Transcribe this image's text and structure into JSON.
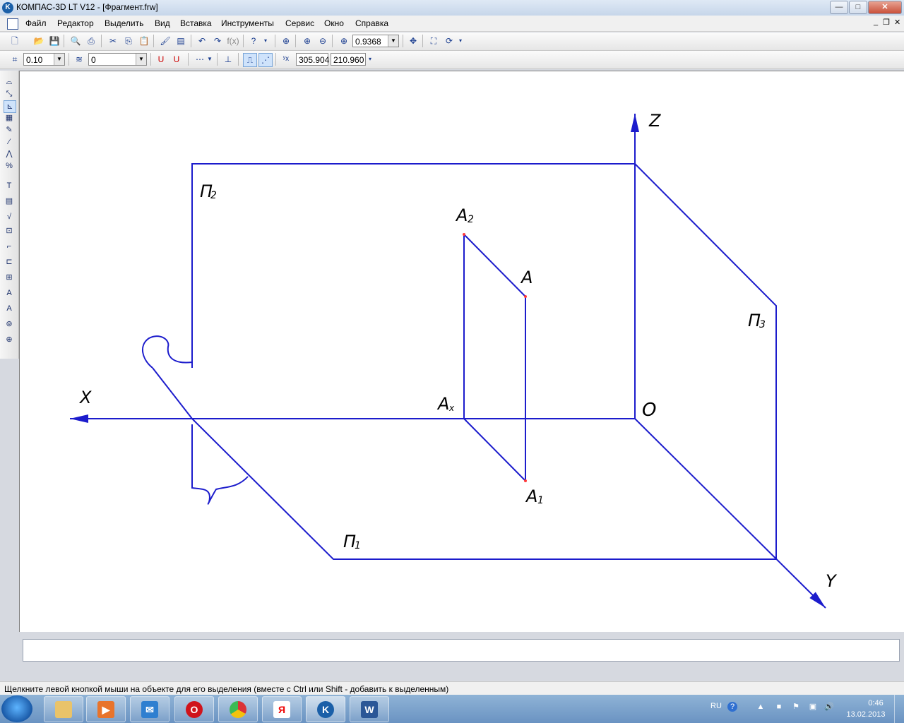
{
  "window": {
    "title": "КОМПАС-3D LT V12 - [Фрагмент.frw]",
    "app_icon_letter": "K",
    "minimize": "—",
    "maximize": "□",
    "close": "✕"
  },
  "menu": [
    "Файл",
    "Редактор",
    "Выделить",
    "Вид",
    "Вставка",
    "Инструменты",
    "Сервис",
    "Окно",
    "Справка"
  ],
  "toolbar_main": {
    "zoom_value": "0.9368"
  },
  "toolbar_current": {
    "step_value": "0.10",
    "layer_value": "0",
    "coord_x": "305.904",
    "coord_y": "210.960"
  },
  "drawing": {
    "labels": {
      "z_axis": "Z",
      "x_axis": "X",
      "y_axis": "Y",
      "origin": "O",
      "plane_p2": "П",
      "plane_p2_sub": "2",
      "plane_p1": "П",
      "plane_p1_sub": "1",
      "plane_p3": "П",
      "plane_p3_sub": "3",
      "point_a": "A",
      "point_a2": "A",
      "point_a2_sub": "2",
      "point_a1": "A",
      "point_a1_sub": "1",
      "point_ax": "A",
      "point_ax_sub": "x"
    },
    "line_color": "#1c1ccc",
    "point_color": "#ff3b3b"
  },
  "status": {
    "hint": "Щелкните левой кнопкой мыши на объекте для его выделения (вместе с Ctrl или Shift - добавить к выделенным)"
  },
  "taskbar": {
    "apps": [
      "explorer",
      "media-player",
      "mail",
      "opera",
      "chrome",
      "yandex",
      "kompas",
      "word"
    ],
    "yandex_letter": "Я",
    "word_letter": "W",
    "lang": "RU",
    "time": "0:46",
    "date": "13.02.2013"
  }
}
